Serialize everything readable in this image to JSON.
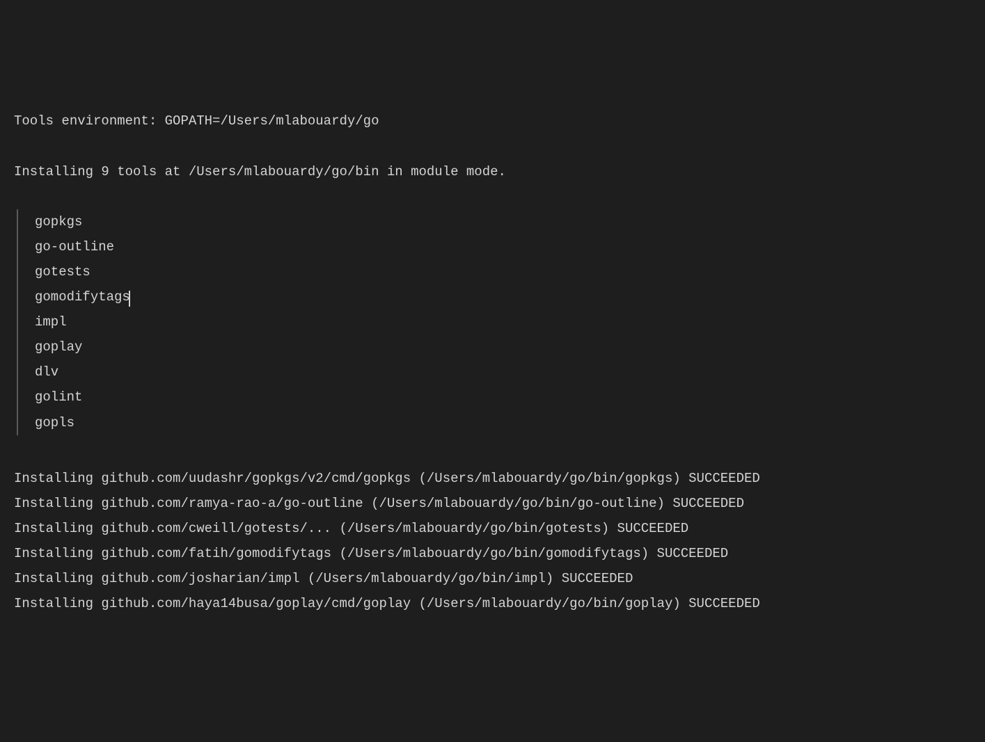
{
  "header": {
    "line1": "Tools environment: GOPATH=/Users/mlabouardy/go",
    "line2": "Installing 9 tools at /Users/mlabouardy/go/bin in module mode."
  },
  "tools": [
    "gopkgs",
    "go-outline",
    "gotests",
    "gomodifytags",
    "impl",
    "goplay",
    "dlv",
    "golint",
    "gopls"
  ],
  "cursor_after_index": 3,
  "install_lines": [
    "Installing github.com/uudashr/gopkgs/v2/cmd/gopkgs (/Users/mlabouardy/go/bin/gopkgs) SUCCEEDED",
    "Installing github.com/ramya-rao-a/go-outline (/Users/mlabouardy/go/bin/go-outline) SUCCEEDED",
    "Installing github.com/cweill/gotests/... (/Users/mlabouardy/go/bin/gotests) SUCCEEDED",
    "Installing github.com/fatih/gomodifytags (/Users/mlabouardy/go/bin/gomodifytags) SUCCEEDED",
    "Installing github.com/josharian/impl (/Users/mlabouardy/go/bin/impl) SUCCEEDED",
    "Installing github.com/haya14busa/goplay/cmd/goplay (/Users/mlabouardy/go/bin/goplay) SUCCEEDED"
  ]
}
